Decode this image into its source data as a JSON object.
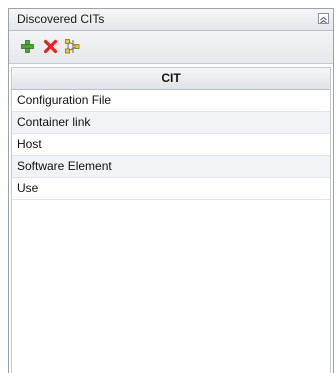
{
  "panel": {
    "title": "Discovered CITs"
  },
  "toolbar": {
    "buttons": [
      {
        "icon": "add-icon",
        "color": "#3f9a2b"
      },
      {
        "icon": "delete-icon",
        "color": "#e0261c"
      },
      {
        "icon": "topology-icon",
        "color": "#c9a22a"
      }
    ]
  },
  "table": {
    "column_header": "CIT",
    "rows": [
      "Configuration File",
      "Container link",
      "Host",
      "Software Element",
      "Use"
    ]
  }
}
